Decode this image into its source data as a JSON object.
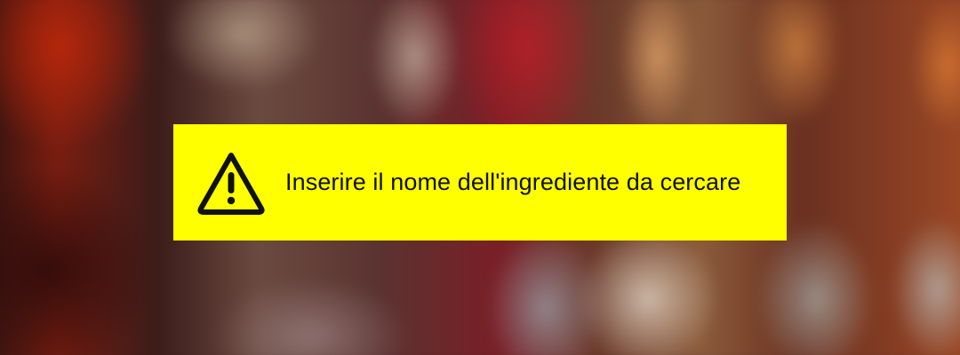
{
  "toast": {
    "icon": "warning-icon",
    "message": "Inserire il nome dell'ingrediente da cercare"
  },
  "colors": {
    "toast_background": "#ffff00",
    "toast_text": "#111111"
  }
}
